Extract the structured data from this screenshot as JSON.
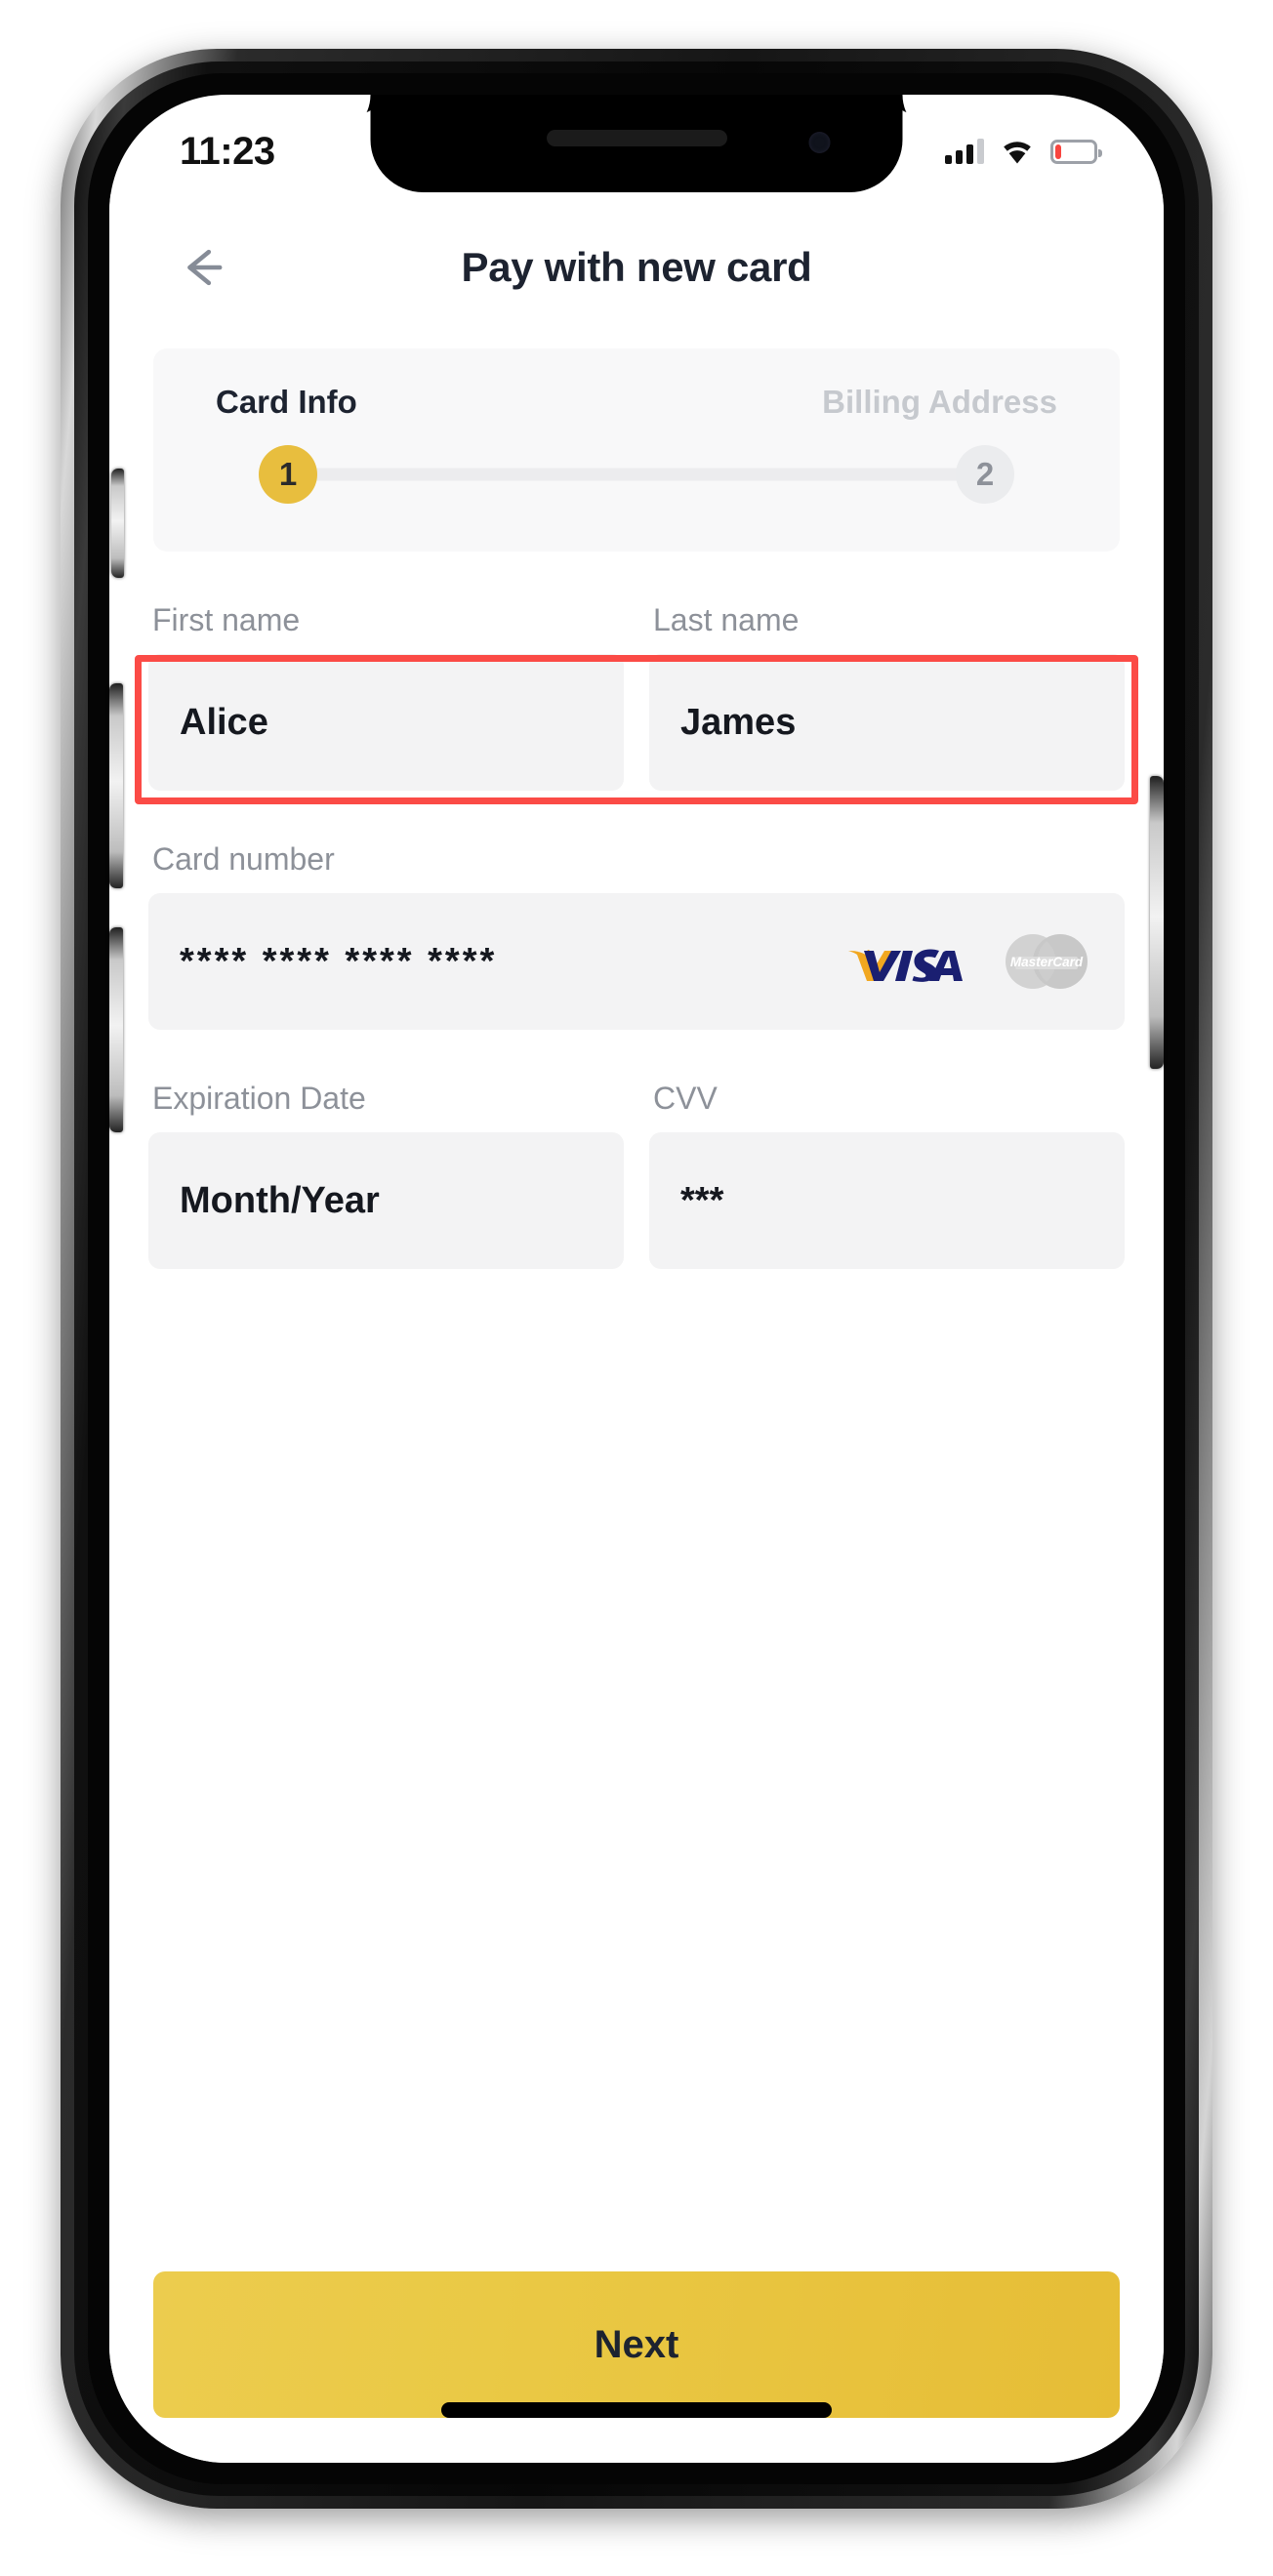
{
  "status_bar": {
    "time": "11:23",
    "cellular_icon": "cellular-signal-icon",
    "cellular_bars_filled": 3,
    "cellular_bars_total": 4,
    "wifi_icon": "wifi-icon",
    "battery_icon": "battery-low-icon",
    "battery_level_percent": 15,
    "battery_color": "#f8453f"
  },
  "navbar": {
    "back_icon": "arrow-left-icon",
    "title": "Pay with new card"
  },
  "stepper": {
    "steps": [
      {
        "number": "1",
        "label": "Card Info",
        "state": "active"
      },
      {
        "number": "2",
        "label": "Billing Address",
        "state": "inactive"
      }
    ],
    "active_color": "#e8be3e",
    "inactive_color": "#ebecee"
  },
  "form": {
    "first_name": {
      "label": "First name",
      "value": "Alice"
    },
    "last_name": {
      "label": "Last name",
      "value": "James"
    },
    "card_number": {
      "label": "Card number",
      "value": "**** **** **** ****",
      "brands": [
        {
          "name": "visa-logo",
          "text": "VISA",
          "state": "selected"
        },
        {
          "name": "mastercard-logo",
          "text": "MasterCard",
          "state": "dimmed"
        }
      ]
    },
    "expiration": {
      "label": "Expiration Date",
      "value": "Month/Year"
    },
    "cvv": {
      "label": "CVV",
      "value": "***"
    }
  },
  "highlight": {
    "target": "name-fields",
    "color": "#fb4b46"
  },
  "footer": {
    "next_label": "Next",
    "next_color": "#e8c445"
  },
  "device": {
    "home_indicator": "home-indicator",
    "buttons": [
      "mute-switch",
      "volume-up-button",
      "volume-down-button",
      "power-button"
    ]
  }
}
